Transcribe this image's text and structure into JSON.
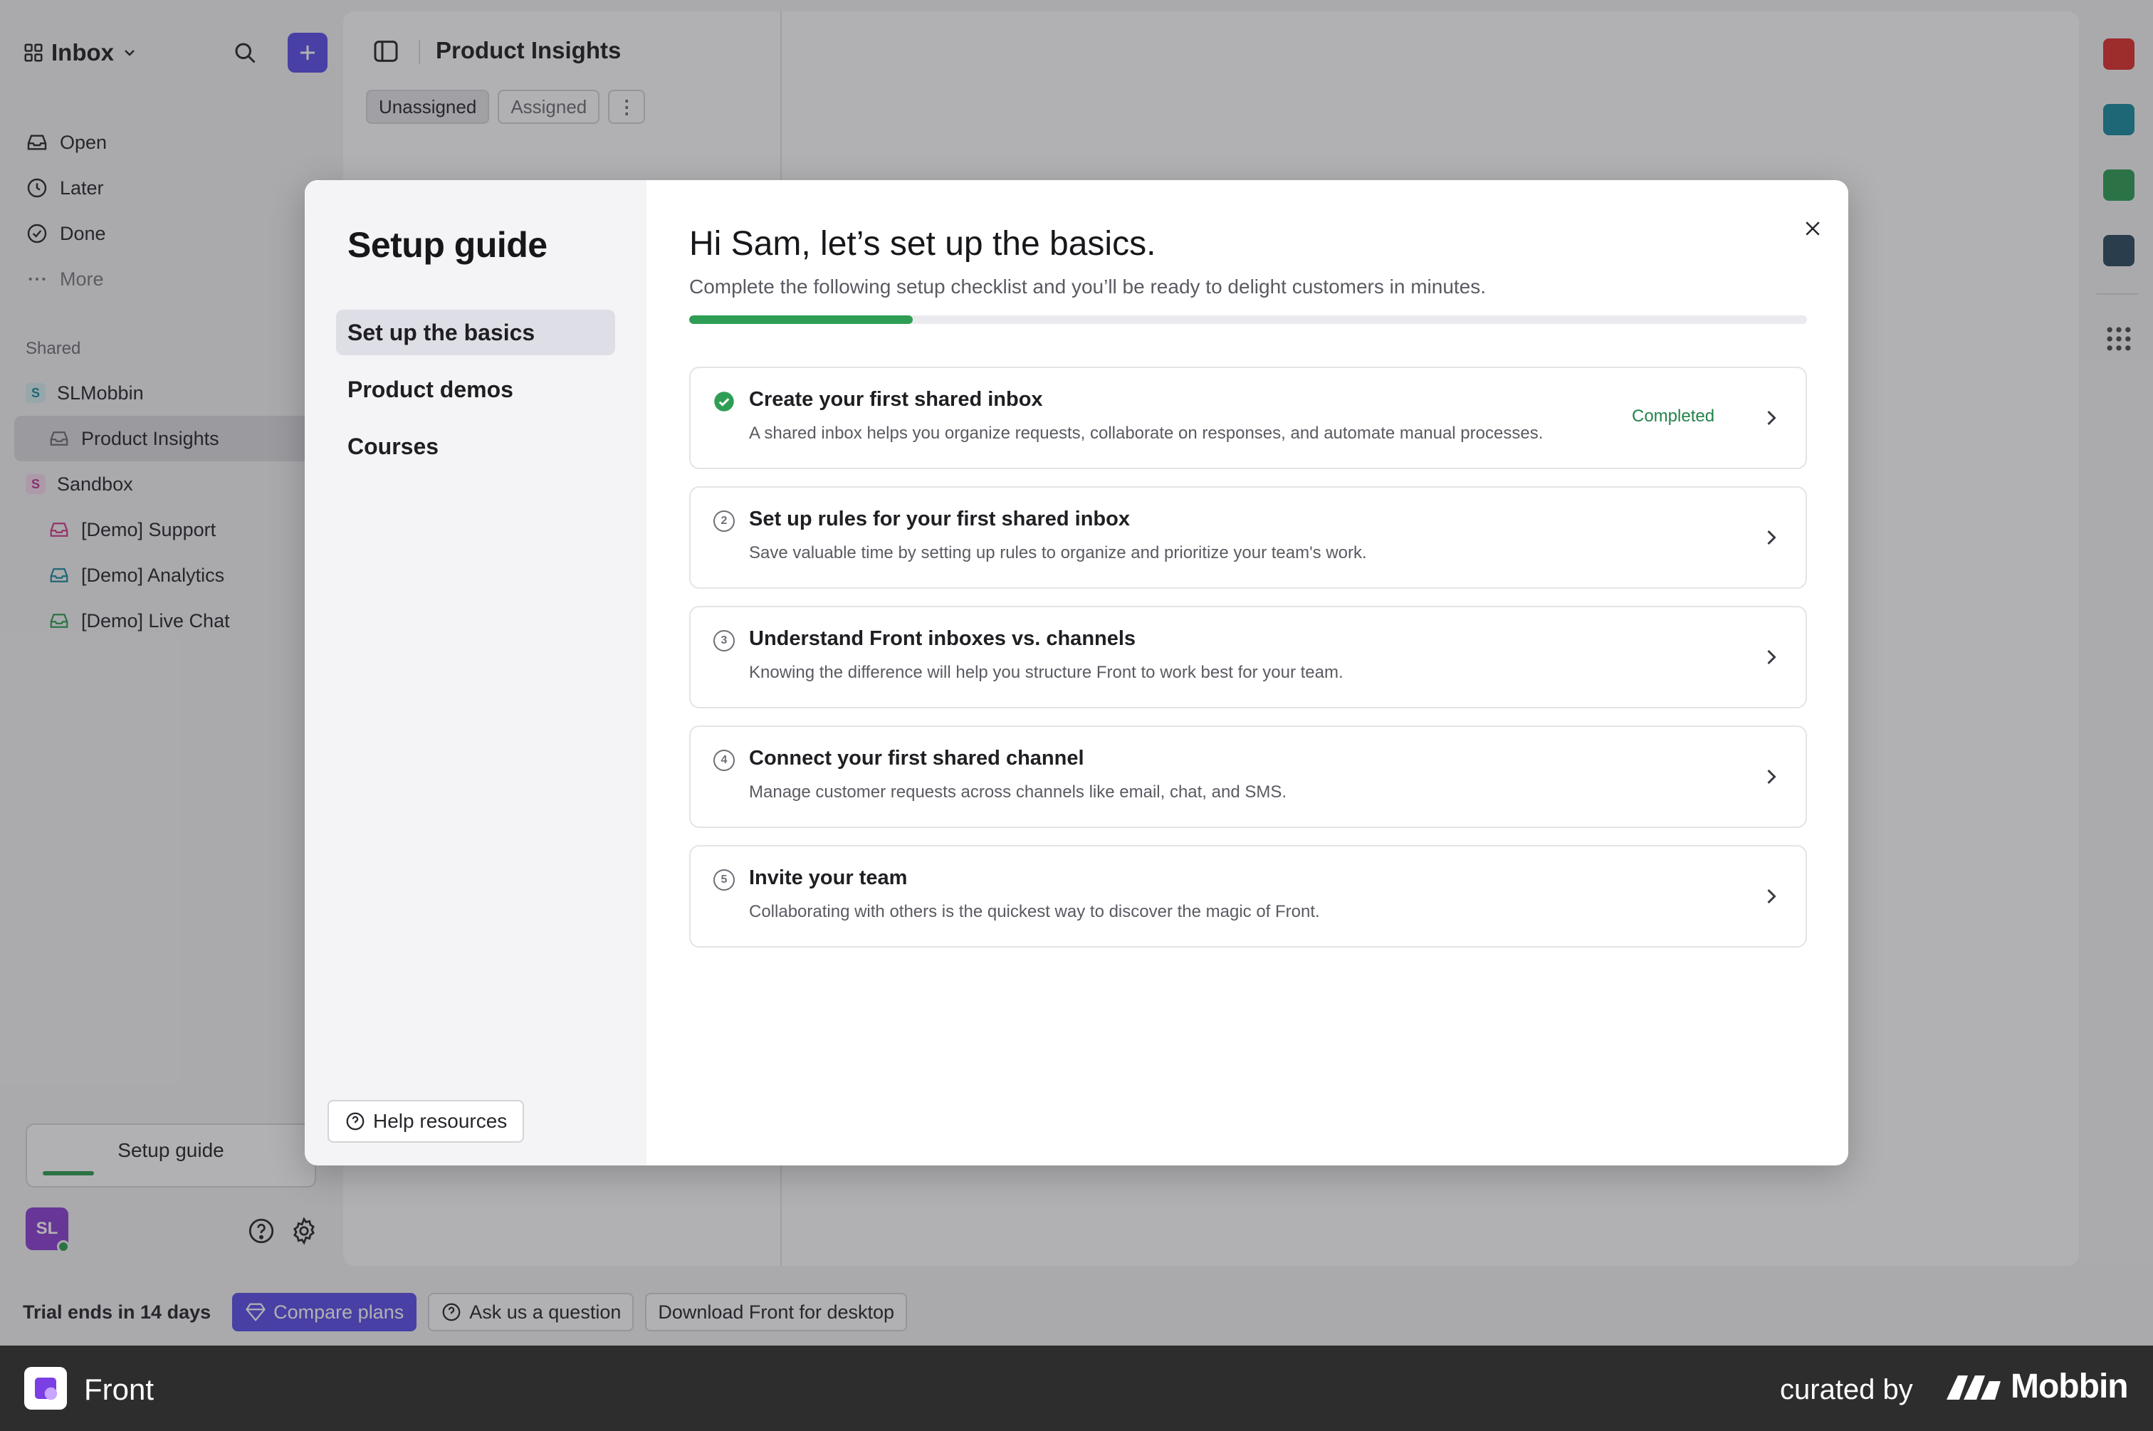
{
  "sidebar": {
    "inbox_label": "Inbox",
    "nav": [
      {
        "label": "Open",
        "icon": "inbox-tray-icon"
      },
      {
        "label": "Later",
        "icon": "clock-icon"
      },
      {
        "label": "Done",
        "icon": "check-circle-icon"
      },
      {
        "label": "More",
        "icon": "ellipsis-icon"
      }
    ],
    "shared_label": "Shared",
    "workspaces": [
      {
        "label": "SLMobbin",
        "badge": "S",
        "color": "#1a8ca0"
      },
      {
        "label": "Product Insights",
        "color": "#6e6e76"
      },
      {
        "label": "Sandbox",
        "badge": "S",
        "color": "#c0389a"
      },
      {
        "label": "[Demo] Support",
        "color": "#d43a8a"
      },
      {
        "label": "[Demo] Analytics",
        "color": "#1a8ca0"
      },
      {
        "label": "[Demo] Live Chat",
        "color": "#2e9e55"
      }
    ],
    "setup_guide_label": "Setup guide",
    "setup_progress": 0.2,
    "avatar_initials": "SL"
  },
  "panel": {
    "title": "Product Insights",
    "tabs": [
      "Unassigned",
      "Assigned"
    ],
    "tab_more": "⋮"
  },
  "footer": {
    "trial": "Trial ends in 14 days",
    "compare_plans": "Compare plans",
    "ask_question": "Ask us a question",
    "download": "Download Front for desktop"
  },
  "modal": {
    "side_title": "Setup guide",
    "side_items": [
      "Set up the basics",
      "Product demos",
      "Courses"
    ],
    "help_resources": "Help resources",
    "title": "Hi Sam, let’s set up the basics.",
    "subtitle": "Complete the following setup checklist and you’ll be ready to delight customers in minutes.",
    "progress": 0.2,
    "steps": [
      {
        "num": "1",
        "title": "Create your first shared inbox",
        "desc": "A shared inbox helps you organize requests, collaborate on responses, and automate manual processes.",
        "status": "Completed"
      },
      {
        "num": "2",
        "title": "Set up rules for your first shared inbox",
        "desc": "Save valuable time by setting up rules to organize and prioritize your team's work.",
        "status": ""
      },
      {
        "num": "3",
        "title": "Understand Front inboxes vs. channels",
        "desc": "Knowing the difference will help you structure Front to work best for your team.",
        "status": ""
      },
      {
        "num": "4",
        "title": "Connect your first shared channel",
        "desc": "Manage customer requests across channels like email, chat, and SMS.",
        "status": ""
      },
      {
        "num": "5",
        "title": "Invite your team",
        "desc": "Collaborating with others is the quickest way to discover the magic of Front.",
        "status": ""
      }
    ]
  },
  "brand": {
    "app_name": "Front",
    "curated_by": "curated by",
    "mobbin": "Mobbin"
  },
  "colors": {
    "accent": "#5b4fe8",
    "success": "#2e9e55"
  }
}
